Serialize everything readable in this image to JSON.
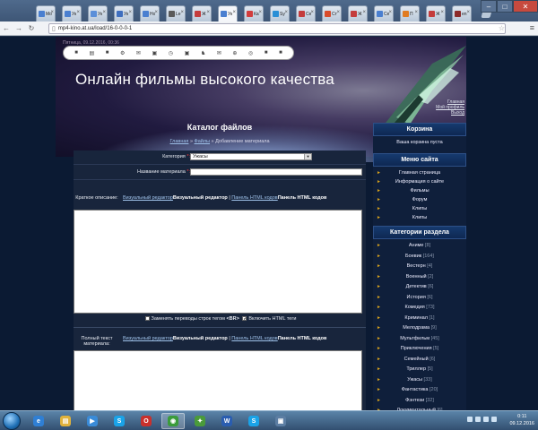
{
  "browser": {
    "tabs": [
      {
        "label": "Mo",
        "color": "#4a7fd0",
        "active": false
      },
      {
        "label": "Ук",
        "color": "#4a7fd0",
        "active": false
      },
      {
        "label": "Ук",
        "color": "#5b8fd9",
        "active": false
      },
      {
        "label": "Ук",
        "color": "#3f6fbf",
        "active": false
      },
      {
        "label": "Но",
        "color": "#4a7fd0",
        "active": false
      },
      {
        "label": "Le",
        "color": "#5a5a5a",
        "active": false
      },
      {
        "label": "Ж",
        "color": "#c43c3c",
        "active": false
      },
      {
        "label": "Ук",
        "color": "#4a7fd0",
        "active": true
      },
      {
        "label": "Ка",
        "color": "#d23d3d",
        "active": false
      },
      {
        "label": "Sy",
        "color": "#2a8fd6",
        "active": false
      },
      {
        "label": "Се",
        "color": "#c43c3c",
        "active": false
      },
      {
        "label": "Ст",
        "color": "#d84b2b",
        "active": false
      },
      {
        "label": "Ж",
        "color": "#c43c3c",
        "active": false
      },
      {
        "label": "Се",
        "color": "#4a7fd0",
        "active": false
      },
      {
        "label": "П",
        "color": "#e07b21",
        "active": false
      },
      {
        "label": "Ж",
        "color": "#c43c3c",
        "active": false
      },
      {
        "label": "en",
        "color": "#8c2a2a",
        "active": false
      }
    ],
    "url": "mp4-kino.at.ua/load/16-0-0-0-1",
    "star_icon": "☆",
    "menu_icon": "≡",
    "window_controls": {
      "minimize": "–",
      "maximize": "□",
      "close": "✕"
    }
  },
  "bookmarks_bar": {
    "icons": [
      "■",
      "▤",
      "■",
      "⚙",
      "✉",
      "▣",
      "◷",
      "▣",
      "♞",
      "✉",
      "⊕",
      "◎",
      "■",
      "■"
    ]
  },
  "site": {
    "date": "Пятница, 09.12.2016, 00:36",
    "title": "Онлайн фильмы высокого качества",
    "user_links": [
      "Главная",
      "Мой профиль",
      "Выход"
    ]
  },
  "content": {
    "heading": "Каталог файлов",
    "breadcrumb": {
      "home": "Главная",
      "sep1": "»",
      "files": "Файлы",
      "sep2": "»",
      "current": "Добавление материала"
    },
    "form": {
      "category_label": "Категория",
      "required_mark": "*:",
      "category_value": "Ужасы",
      "title_label": "Название материала",
      "short_desc_label": "Краткое описание:",
      "editor_links": {
        "visual_link": "Визуальный редактор",
        "visual_bold": "Визуальный редактор",
        "separator": "|",
        "html_link": "Панель HTML кодов",
        "html_bold": "Панель HTML кодов"
      },
      "option_br": "Заменять переводы строк тегом",
      "option_br_tag": "<BR>",
      "option_html": "Включить HTML теги",
      "full_text_label": "Полный текст материала:"
    }
  },
  "sidebar": {
    "cart": {
      "title": "Корзина",
      "empty": "Ваша корзина пуста"
    },
    "menu": {
      "title": "Меню сайта",
      "items": [
        "Главная страница",
        "Информация о сайте",
        "Фильмы",
        "Форум",
        "Клипы",
        "Клипы"
      ]
    },
    "categories": {
      "title": "Категории раздела",
      "items": [
        {
          "name": "Аниме",
          "count": "[8]"
        },
        {
          "name": "Боевик",
          "count": "[164]"
        },
        {
          "name": "Вестерн",
          "count": "[4]"
        },
        {
          "name": "Военный",
          "count": "[2]"
        },
        {
          "name": "Детектив",
          "count": "[6]"
        },
        {
          "name": "История",
          "count": "[6]"
        },
        {
          "name": "Комедия",
          "count": "[73]"
        },
        {
          "name": "Криминал",
          "count": "[1]"
        },
        {
          "name": "Мелодрама",
          "count": "[9]"
        },
        {
          "name": "Мультфильм",
          "count": "[45]"
        },
        {
          "name": "Приключения",
          "count": "[5]"
        },
        {
          "name": "Семейный",
          "count": "[6]"
        },
        {
          "name": "Триллер",
          "count": "[5]"
        },
        {
          "name": "Ужасы",
          "count": "[33]"
        },
        {
          "name": "Фантастика",
          "count": "[20]"
        },
        {
          "name": "Фэнтези",
          "count": "[32]"
        },
        {
          "name": "Документальный",
          "count": "[6]"
        }
      ]
    }
  },
  "taskbar": {
    "items": [
      {
        "name": "ie",
        "glyph": "e",
        "color": "#2f7fd4"
      },
      {
        "name": "explorer",
        "glyph": "▤",
        "color": "#e0b23c"
      },
      {
        "name": "media-player",
        "glyph": "▶",
        "color": "#3a8bd8"
      },
      {
        "name": "skype",
        "glyph": "S",
        "color": "#1aa3e8"
      },
      {
        "name": "opera",
        "glyph": "O",
        "color": "#c9302c"
      },
      {
        "name": "chrome",
        "glyph": "◉",
        "color": "#3b9b3b"
      },
      {
        "name": "network",
        "glyph": "✦",
        "color": "#4a9b3a"
      },
      {
        "name": "word",
        "glyph": "W",
        "color": "#2a5db0"
      },
      {
        "name": "skype-2",
        "glyph": "S",
        "color": "#1aa3e8"
      },
      {
        "name": "app-window",
        "glyph": "▣",
        "color": "#5c7ea3"
      }
    ],
    "clock_time": "0:11",
    "clock_date": "09.12.2016"
  }
}
